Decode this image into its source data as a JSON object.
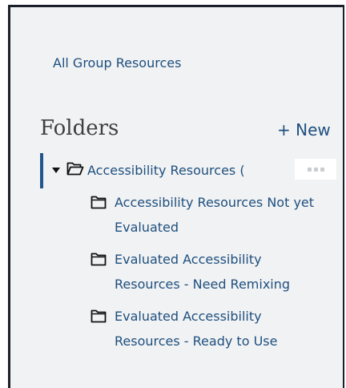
{
  "links": {
    "all_group_resources": "All Group Resources"
  },
  "folders": {
    "heading": "Folders",
    "new_label": "+ New",
    "root": {
      "label": "Accessibility Resources (",
      "expanded": true
    },
    "children": [
      {
        "label": "Accessibility Resources Not yet Evaluated"
      },
      {
        "label": "Evaluated Accessibility Resources - Need Remixing"
      },
      {
        "label": "Evaluated Accessibility Resources - Ready to Use"
      }
    ]
  },
  "icons": {
    "caret": "caret-down-icon",
    "open_folder": "folder-open-icon",
    "closed_folder": "folder-icon",
    "more": "more-options-icon"
  },
  "colors": {
    "link": "#1e4f7f",
    "heading": "#3e3f42",
    "active_bar": "#23568d",
    "panel_bg": "#f1f2f3",
    "border": "#1a1f29"
  }
}
